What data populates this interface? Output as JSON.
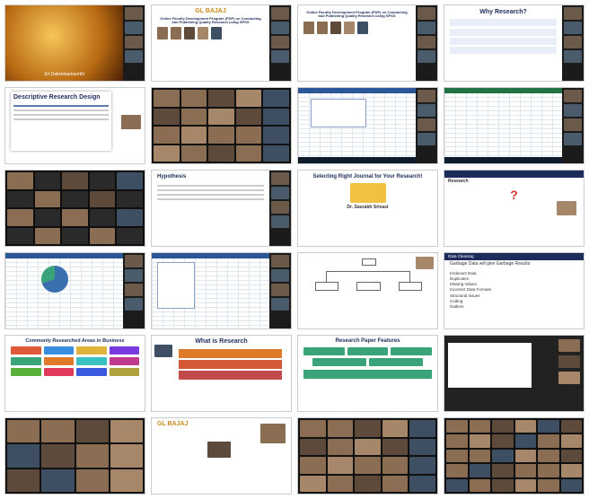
{
  "tiles": {
    "t1": {
      "caption": "Sri Dakshinamoorthi"
    },
    "t2": {
      "brand": "GL BAJAJ",
      "title": "Online Faculty Development Program (FDP) on Conducting and Publishing Quality Research using SPSS"
    },
    "t3": {
      "title": "Online Faculty Development Program (FDP) on Conducting and Publishing Quality Research using SPSS"
    },
    "t4": {
      "title": "Why Research?"
    },
    "t5": {
      "title": "Descriptive Research Design"
    },
    "t10": {
      "title": "Hypothesis"
    },
    "t11": {
      "title": "Selecting Right Journal for Your Research!",
      "presenter": "Dr. Saurabh Srivast"
    },
    "t12": {
      "title": "Research",
      "symbol": "?"
    },
    "t16": {
      "title": "Data Cleaning",
      "subtitle": "Garbage Data will give Garbage Results",
      "items": [
        "Irrelevant Data",
        "Duplicates",
        "Missing Values",
        "Incorrect Data Formats",
        "Structural Issues",
        "Coding",
        "Outliers"
      ]
    },
    "t17": {
      "title": "Commonly Researched Areas in Business"
    },
    "t18": {
      "title": "What is Research"
    },
    "t19": {
      "title": "Research Paper Features"
    },
    "t22": {
      "brand": "GL BAJAJ"
    }
  },
  "colors": {
    "navy": "#1c2b5a",
    "gold": "#c98a1c",
    "teal": "#3aa37a",
    "orange": "#e07a2b"
  }
}
